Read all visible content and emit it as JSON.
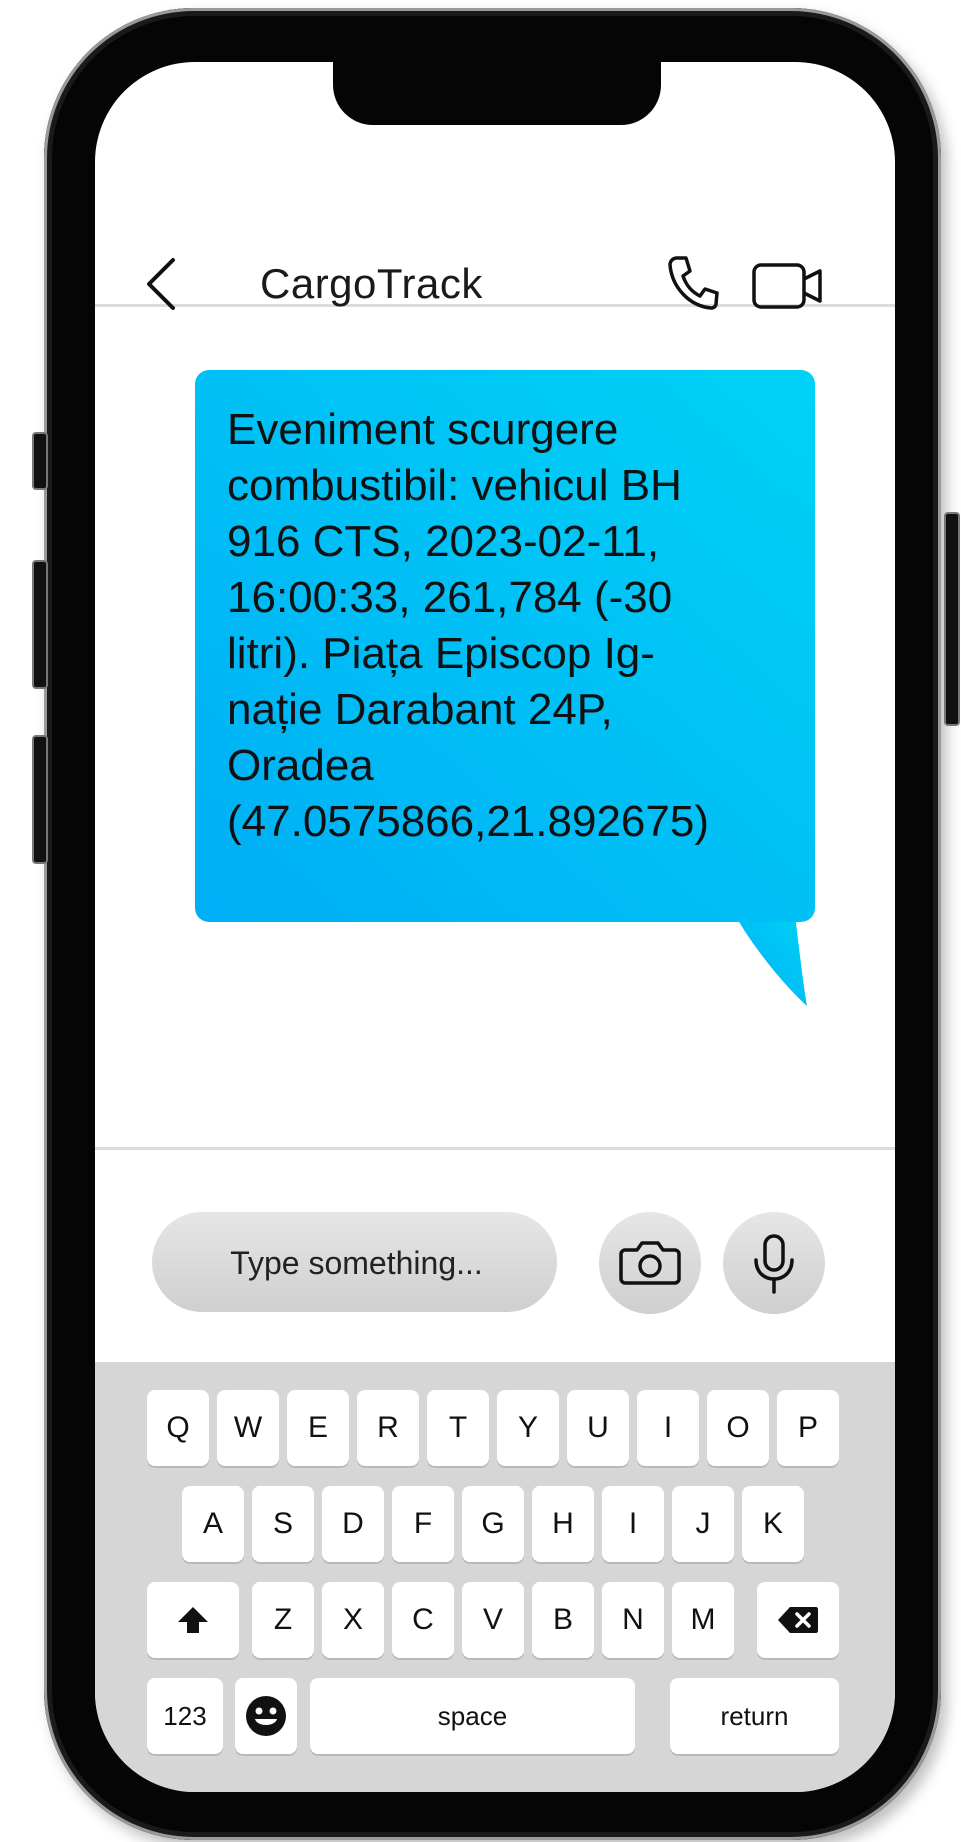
{
  "header": {
    "contact_name": "CargoTrack",
    "back_icon": "chevron-left-icon",
    "call_icon": "phone-icon",
    "video_icon": "video-camera-icon"
  },
  "messages": [
    {
      "direction": "outgoing",
      "text": "Eveniment scurgere\ncombustibil: vehicul BH\n916 CTS, 2023-02-11,\n16:00:33, 261,784 (-30\nlitri). Piața Episcop Ig-\nnație Darabant 24P,\nOradea\n(47.0575866,21.892675)"
    }
  ],
  "composer": {
    "placeholder": "Type something...",
    "camera_icon": "camera-icon",
    "mic_icon": "microphone-icon"
  },
  "keyboard": {
    "row1": [
      "Q",
      "W",
      "E",
      "R",
      "T",
      "Y",
      "U",
      "I",
      "O",
      "P"
    ],
    "row2": [
      "A",
      "S",
      "D",
      "F",
      "G",
      "H",
      "I",
      "J",
      "K"
    ],
    "row3": [
      "Z",
      "X",
      "C",
      "V",
      "B",
      "N",
      "M"
    ],
    "numbers_label": "123",
    "space_label": "space",
    "return_label": "return",
    "shift_icon": "shift-arrow-icon",
    "delete_icon": "backspace-icon",
    "emoji_icon": "emoji-icon"
  },
  "colors": {
    "bubble_start": "#00aef5",
    "bubble_end": "#00d2f6",
    "keyboard_bg": "#d6d6d6",
    "phone_frame": "#050505"
  }
}
